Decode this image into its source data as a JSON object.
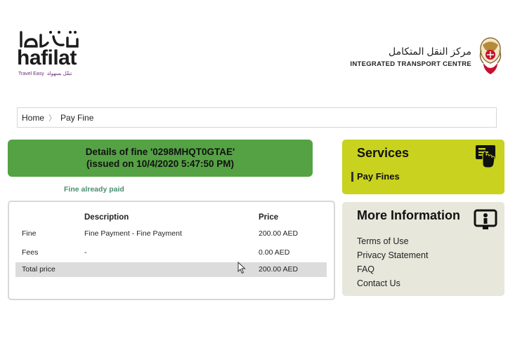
{
  "brand": {
    "hafilat_word": "hafilat",
    "tagline_en": "Travel Easy",
    "tagline_ar": "تنقّل بسهولة",
    "purple": "#6a2c7d"
  },
  "itc": {
    "name_ar": "مركز النقل المتكامل",
    "name_en": "INTEGRATED TRANSPORT CENTRE"
  },
  "breadcrumb": {
    "home": "Home",
    "current": "Pay Fine"
  },
  "fine": {
    "title_line1": "Details of fine '0298MHQT0GTAE'",
    "title_line2": "(issued on 10/4/2020 5:47:50 PM)",
    "status": "Fine already paid",
    "header_color": "#55a245"
  },
  "table": {
    "headers": [
      "",
      "Description",
      "Price"
    ],
    "rows": [
      {
        "label": "Fine",
        "description": "Fine Payment -  Fine Payment",
        "price": "200.00 AED"
      },
      {
        "label": "Fees",
        "description": "-",
        "price": "0.00 AED"
      }
    ],
    "total": {
      "label": "Total price",
      "description": "",
      "price": "200.00 AED"
    }
  },
  "services": {
    "title": "Services",
    "link": "Pay Fines",
    "color": "#c9d21e",
    "icon": "card-tap-icon"
  },
  "more_info": {
    "title": "More Information",
    "icon": "info-screen-icon",
    "links": [
      "Terms of Use",
      "Privacy Statement",
      "FAQ",
      "Contact Us"
    ]
  }
}
